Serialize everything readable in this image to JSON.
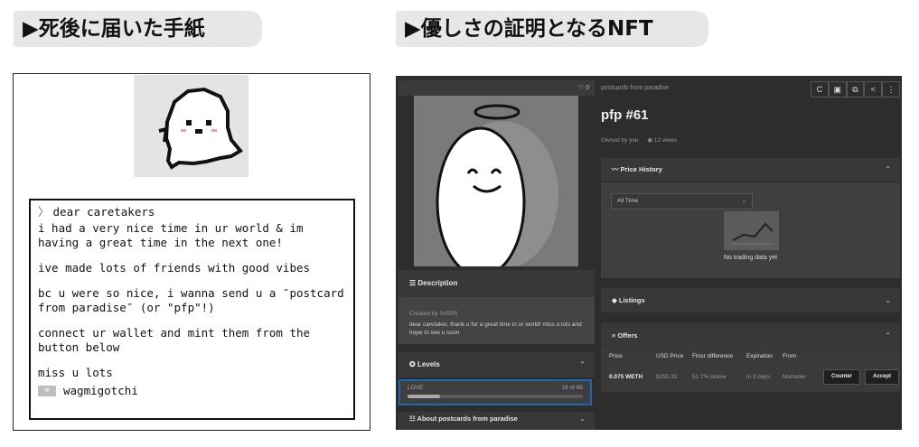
{
  "headers": {
    "left": "▶死後に届いた手紙",
    "right": "▶優しさの証明となるNFT"
  },
  "letter": {
    "prompt": "〉",
    "greeting": "dear caretakers",
    "paragraphs": [
      "i had a very nice time in ur world & im having a great time in the next one!",
      "ive made lots of friends with good vibes",
      "bc u were so nice, i wanna send u a ″postcard from paradise″ (or \"pfp\"!)",
      "connect ur wallet and mint them from the button below",
      "miss u lots"
    ],
    "signature": "wagmigotchi"
  },
  "opensea": {
    "favorites": "♡ 0",
    "collection": "postcards from paradise",
    "title": "pfp #61",
    "owned_by": "Owned by you",
    "views": "12 views",
    "toolbar": [
      "C",
      "▣",
      "⧉",
      "<",
      "⋮"
    ],
    "description": {
      "heading": "Description",
      "created_by": "Created by 0xf295",
      "text": "dear caretaker, thank u for a great time in ur world! miss u lots and hope to see u soon"
    },
    "levels": {
      "heading": "Levels",
      "name": "LOVE",
      "value_text": "16 of 85",
      "fraction": 0.188
    },
    "about": "About postcards from paradise",
    "price_history": {
      "heading": "Price History",
      "select": "All Time",
      "empty": "No trading data yet"
    },
    "listings": "Listings",
    "offers": {
      "heading": "Offers",
      "columns": [
        "Price",
        "USD Price",
        "Floor difference",
        "Expiration",
        "From"
      ],
      "row": {
        "price": "0.075 WETH",
        "usd": "$255.32",
        "floor_diff": "51.7% below",
        "expiration": "in 3 days",
        "from": "Mannder"
      },
      "counter": "Counter",
      "accept": "Accept"
    }
  }
}
